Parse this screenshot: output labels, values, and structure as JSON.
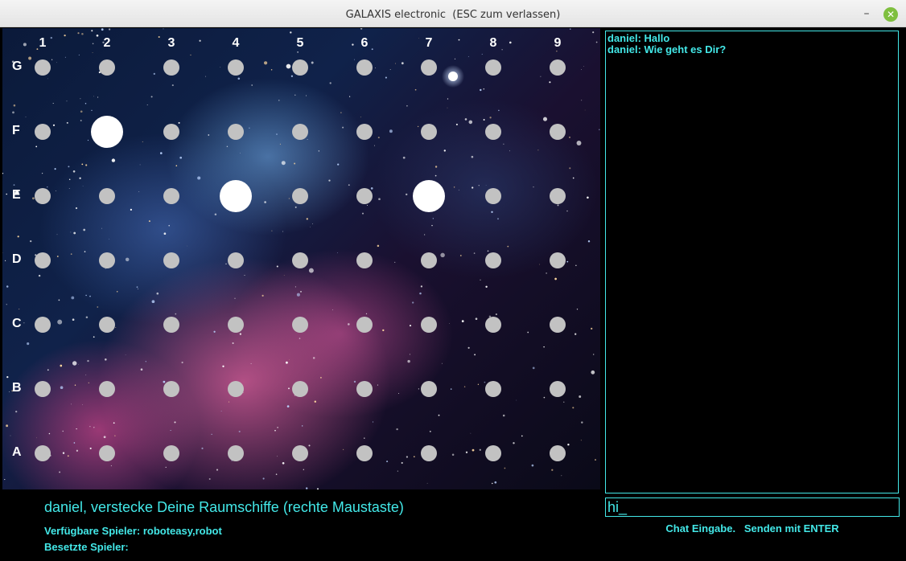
{
  "window": {
    "title": "GALAXIS electronic  (ESC zum verlassen)",
    "minimize_glyph": "–",
    "close_glyph": "✕"
  },
  "board": {
    "columns": [
      "1",
      "2",
      "3",
      "4",
      "5",
      "6",
      "7",
      "8",
      "9"
    ],
    "rows": [
      "G",
      "F",
      "E",
      "D",
      "C",
      "B",
      "A"
    ],
    "ships": [
      "F2",
      "E4",
      "E7"
    ],
    "hole_color": "#c2c2c2",
    "ship_color": "#ffffff",
    "label_color": "#ffffff"
  },
  "status": {
    "message": "daniel, verstecke Deine Raumschiffe (rechte Maustaste)",
    "available_players": "Verfügbare Spieler: roboteasy,robot",
    "occupied_players": "Besetzte Spieler:"
  },
  "chat": {
    "messages": [
      "daniel: Hallo",
      "daniel: Wie geht es Dir?"
    ],
    "input_value": "hi_",
    "hint": "Chat Eingabe.   Senden mit ENTER",
    "accent_color": "#43e8e8"
  }
}
